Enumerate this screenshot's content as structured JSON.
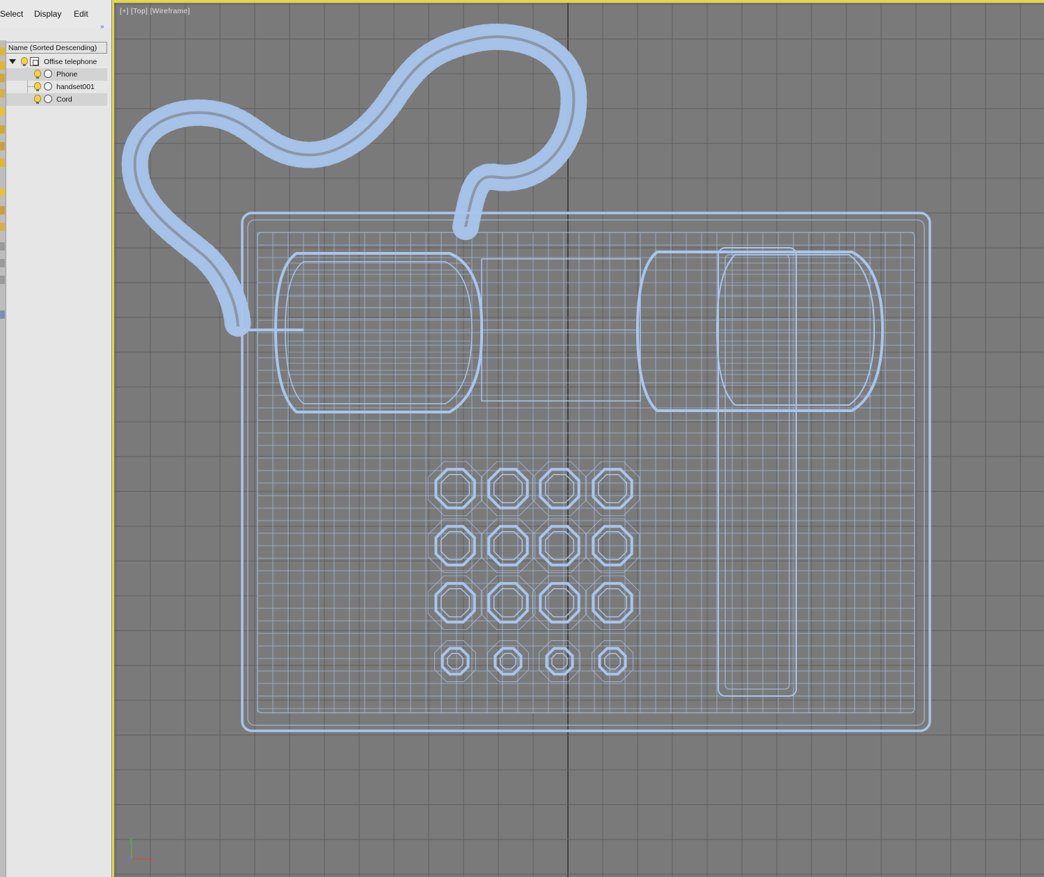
{
  "menu": {
    "select": "Select",
    "display": "Display",
    "edit": "Edit",
    "expand_toggle": "»"
  },
  "explorer": {
    "column_header": "Name (Sorted Descending)",
    "items": [
      {
        "label": "Offise telephone",
        "level": 0,
        "expanded": true,
        "kind": "group"
      },
      {
        "label": "Phone",
        "level": 1,
        "kind": "object"
      },
      {
        "label": "handset001",
        "level": 1,
        "kind": "object"
      },
      {
        "label": "Cord",
        "level": 1,
        "kind": "object"
      }
    ]
  },
  "viewport": {
    "label_plus": "[+]",
    "label_view": "[Top]",
    "label_shading": "[Wireframe]",
    "axis_y": "y",
    "axis_z": "z",
    "axis_x": "x"
  },
  "colors": {
    "viewport_bg": "#7a7a7a",
    "grid_line": "#5f5f5f",
    "grid_axis": "#2c2c2c",
    "wire": "#a9c5ec",
    "active_border": "#e3d64a",
    "panel_bg": "#e6e6e6"
  },
  "icons": [
    "light-bulb-icon",
    "freeze-icon",
    "group-icon",
    "expand-arrow-icon",
    "axis-tripod-icon"
  ]
}
